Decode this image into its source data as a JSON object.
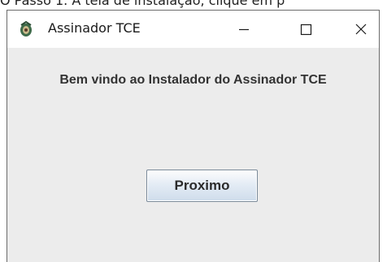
{
  "background": {
    "partial_text": "O Passo 1. A tela de instalação, clique em p"
  },
  "window": {
    "title": "Assinador TCE",
    "icon": "tce-app-icon",
    "controls": {
      "minimize_icon": "minimize-icon",
      "maximize_icon": "maximize-icon",
      "close_icon": "close-icon"
    },
    "heading": "Bem vindo ao Instalador do Assinador TCE",
    "next_button_label": "Proximo",
    "colors": {
      "titlebar": "#ffffff",
      "client_area": "#ececec",
      "heading_text": "#333333"
    }
  }
}
